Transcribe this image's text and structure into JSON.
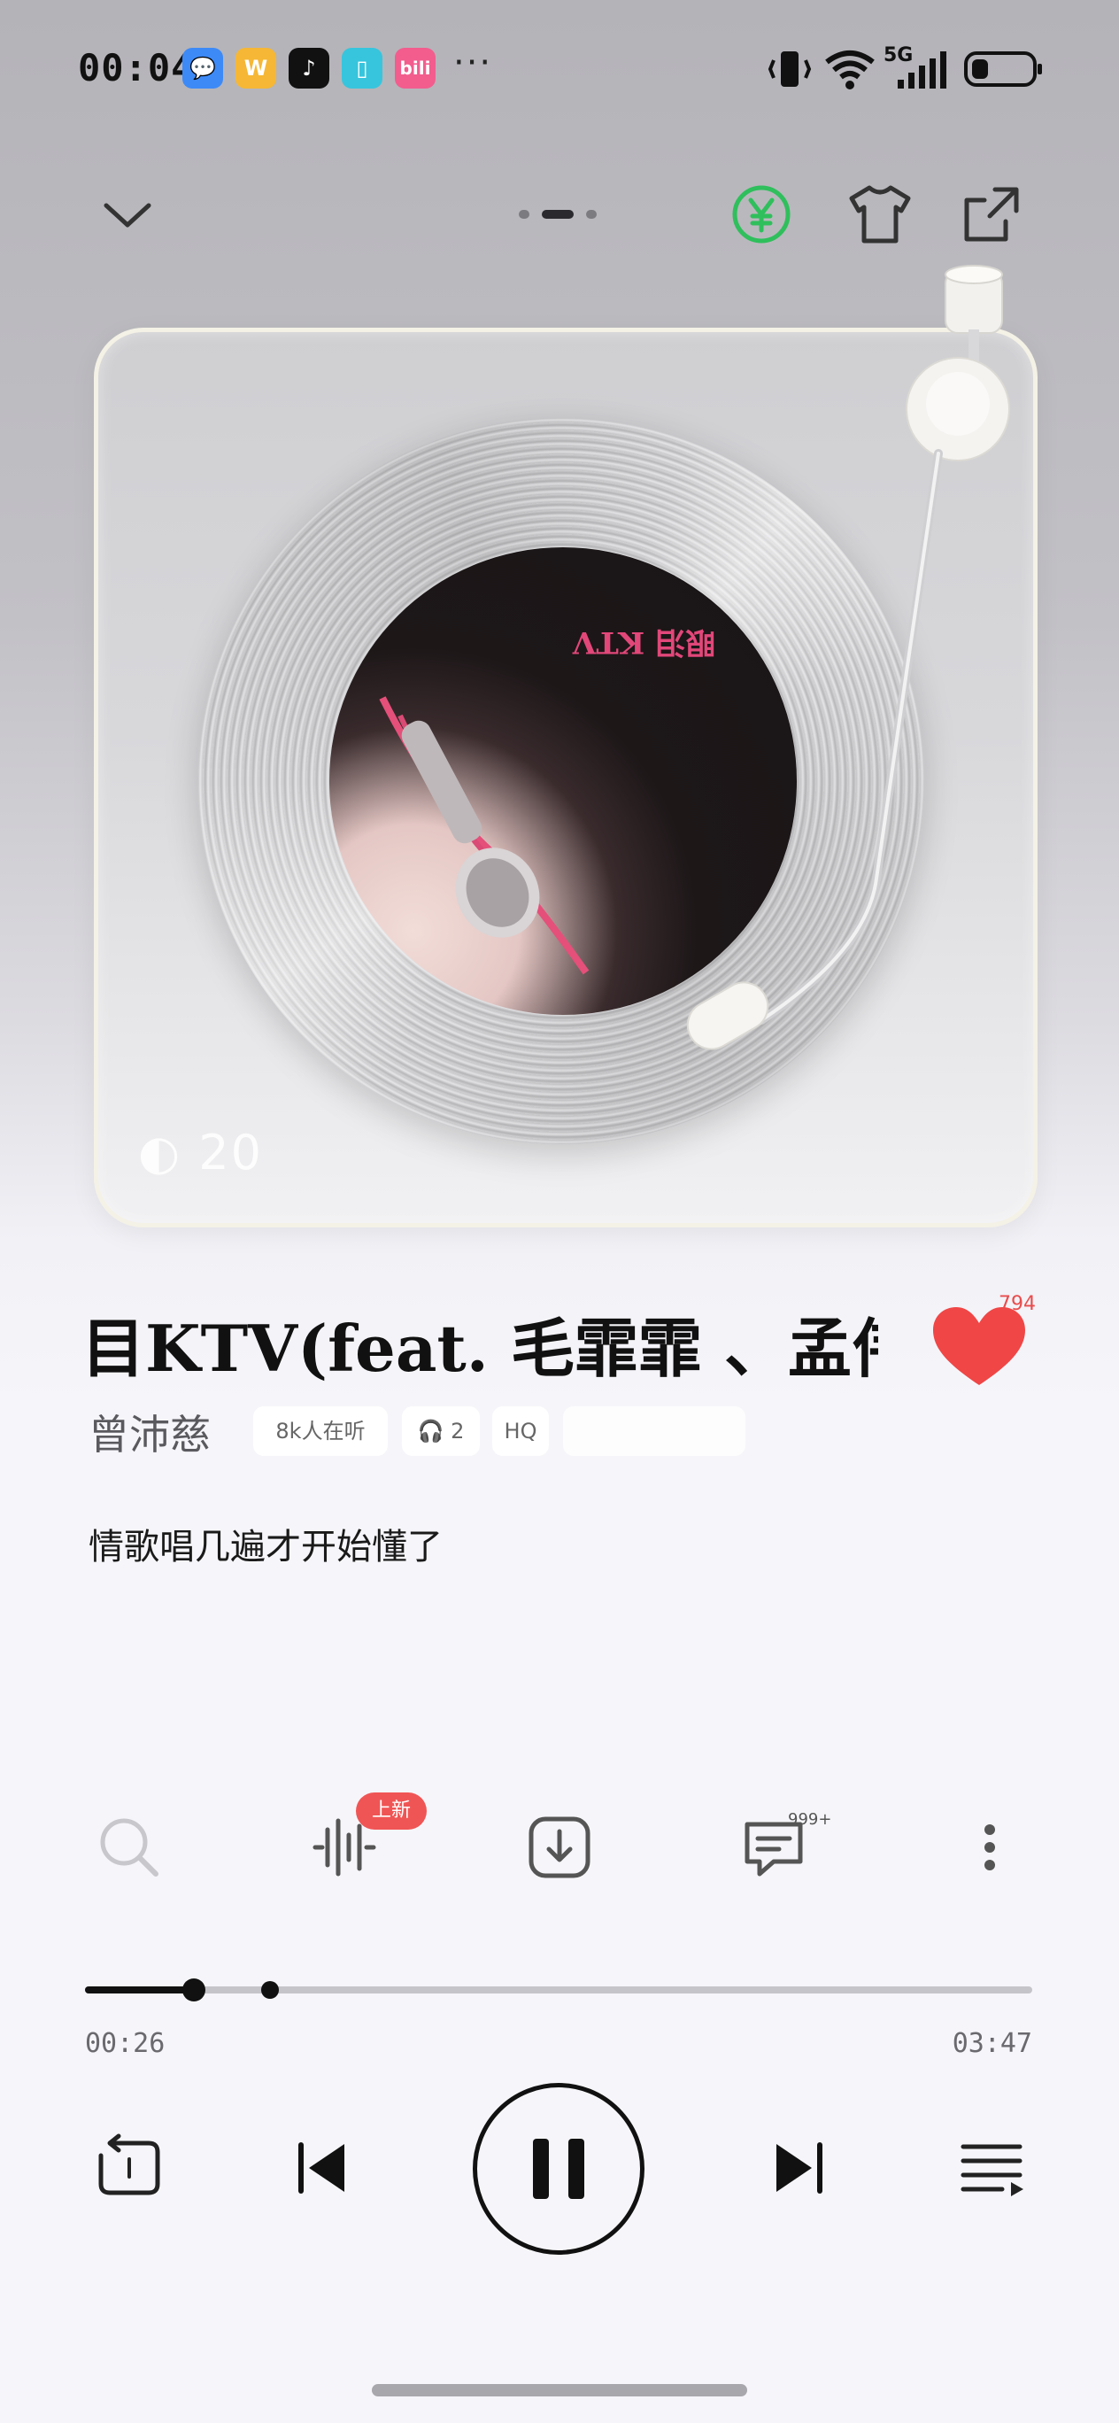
{
  "status_bar": {
    "time": "00:04",
    "more": "···",
    "network": "5G",
    "apps": [
      {
        "name": "messages",
        "color": "#3d8af7",
        "glyph": "💬"
      },
      {
        "name": "weibo",
        "color": "#f5b735",
        "glyph": "W"
      },
      {
        "name": "tiktok",
        "color": "#111111",
        "glyph": "♪"
      },
      {
        "name": "reader",
        "color": "#37c5dd",
        "glyph": "📖"
      },
      {
        "name": "bilibili",
        "color": "#f25d8e",
        "glyph": "b"
      }
    ]
  },
  "player": {
    "album_label_text": "眼泪 KTV",
    "watermark": "20",
    "song_title": "目KTV(feat. 毛霏霏 、孟伟、",
    "like_count": "794",
    "artist": "曾沛慈",
    "tags": [
      "8k人在听",
      "🎧 2",
      "HQ"
    ],
    "lyric": "情歌唱几遍才开始懂了",
    "badge_new": "上新",
    "comments_count": "999+",
    "current_time": "00:26",
    "total_time": "03:47",
    "progress": 0.1145,
    "buffered": 0.195
  },
  "colors": {
    "accent_red": "#f04646",
    "vip_green": "#2fbf5c"
  }
}
